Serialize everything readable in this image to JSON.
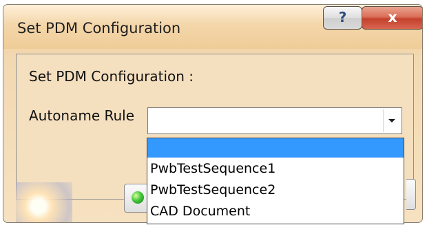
{
  "window": {
    "title": "Set PDM Configuration",
    "help_label": "?",
    "close_label": "x"
  },
  "form": {
    "section_title": "Set PDM Configuration :",
    "field_label": "Autoname Rule",
    "current_value": ""
  },
  "dropdown": {
    "options": [
      "",
      "PwbTestSequence1",
      "PwbTestSequence2",
      "CAD Document"
    ],
    "selected_index": 0
  },
  "colors": {
    "selection": "#3399ff",
    "window_bg": "#f4dfbf",
    "close_red": "#c3412c",
    "ok_green": "#46c63e"
  },
  "icons": {
    "help": "help-icon",
    "close": "close-icon",
    "dropdown": "chevron-down-icon",
    "ok": "green-ok-icon"
  }
}
